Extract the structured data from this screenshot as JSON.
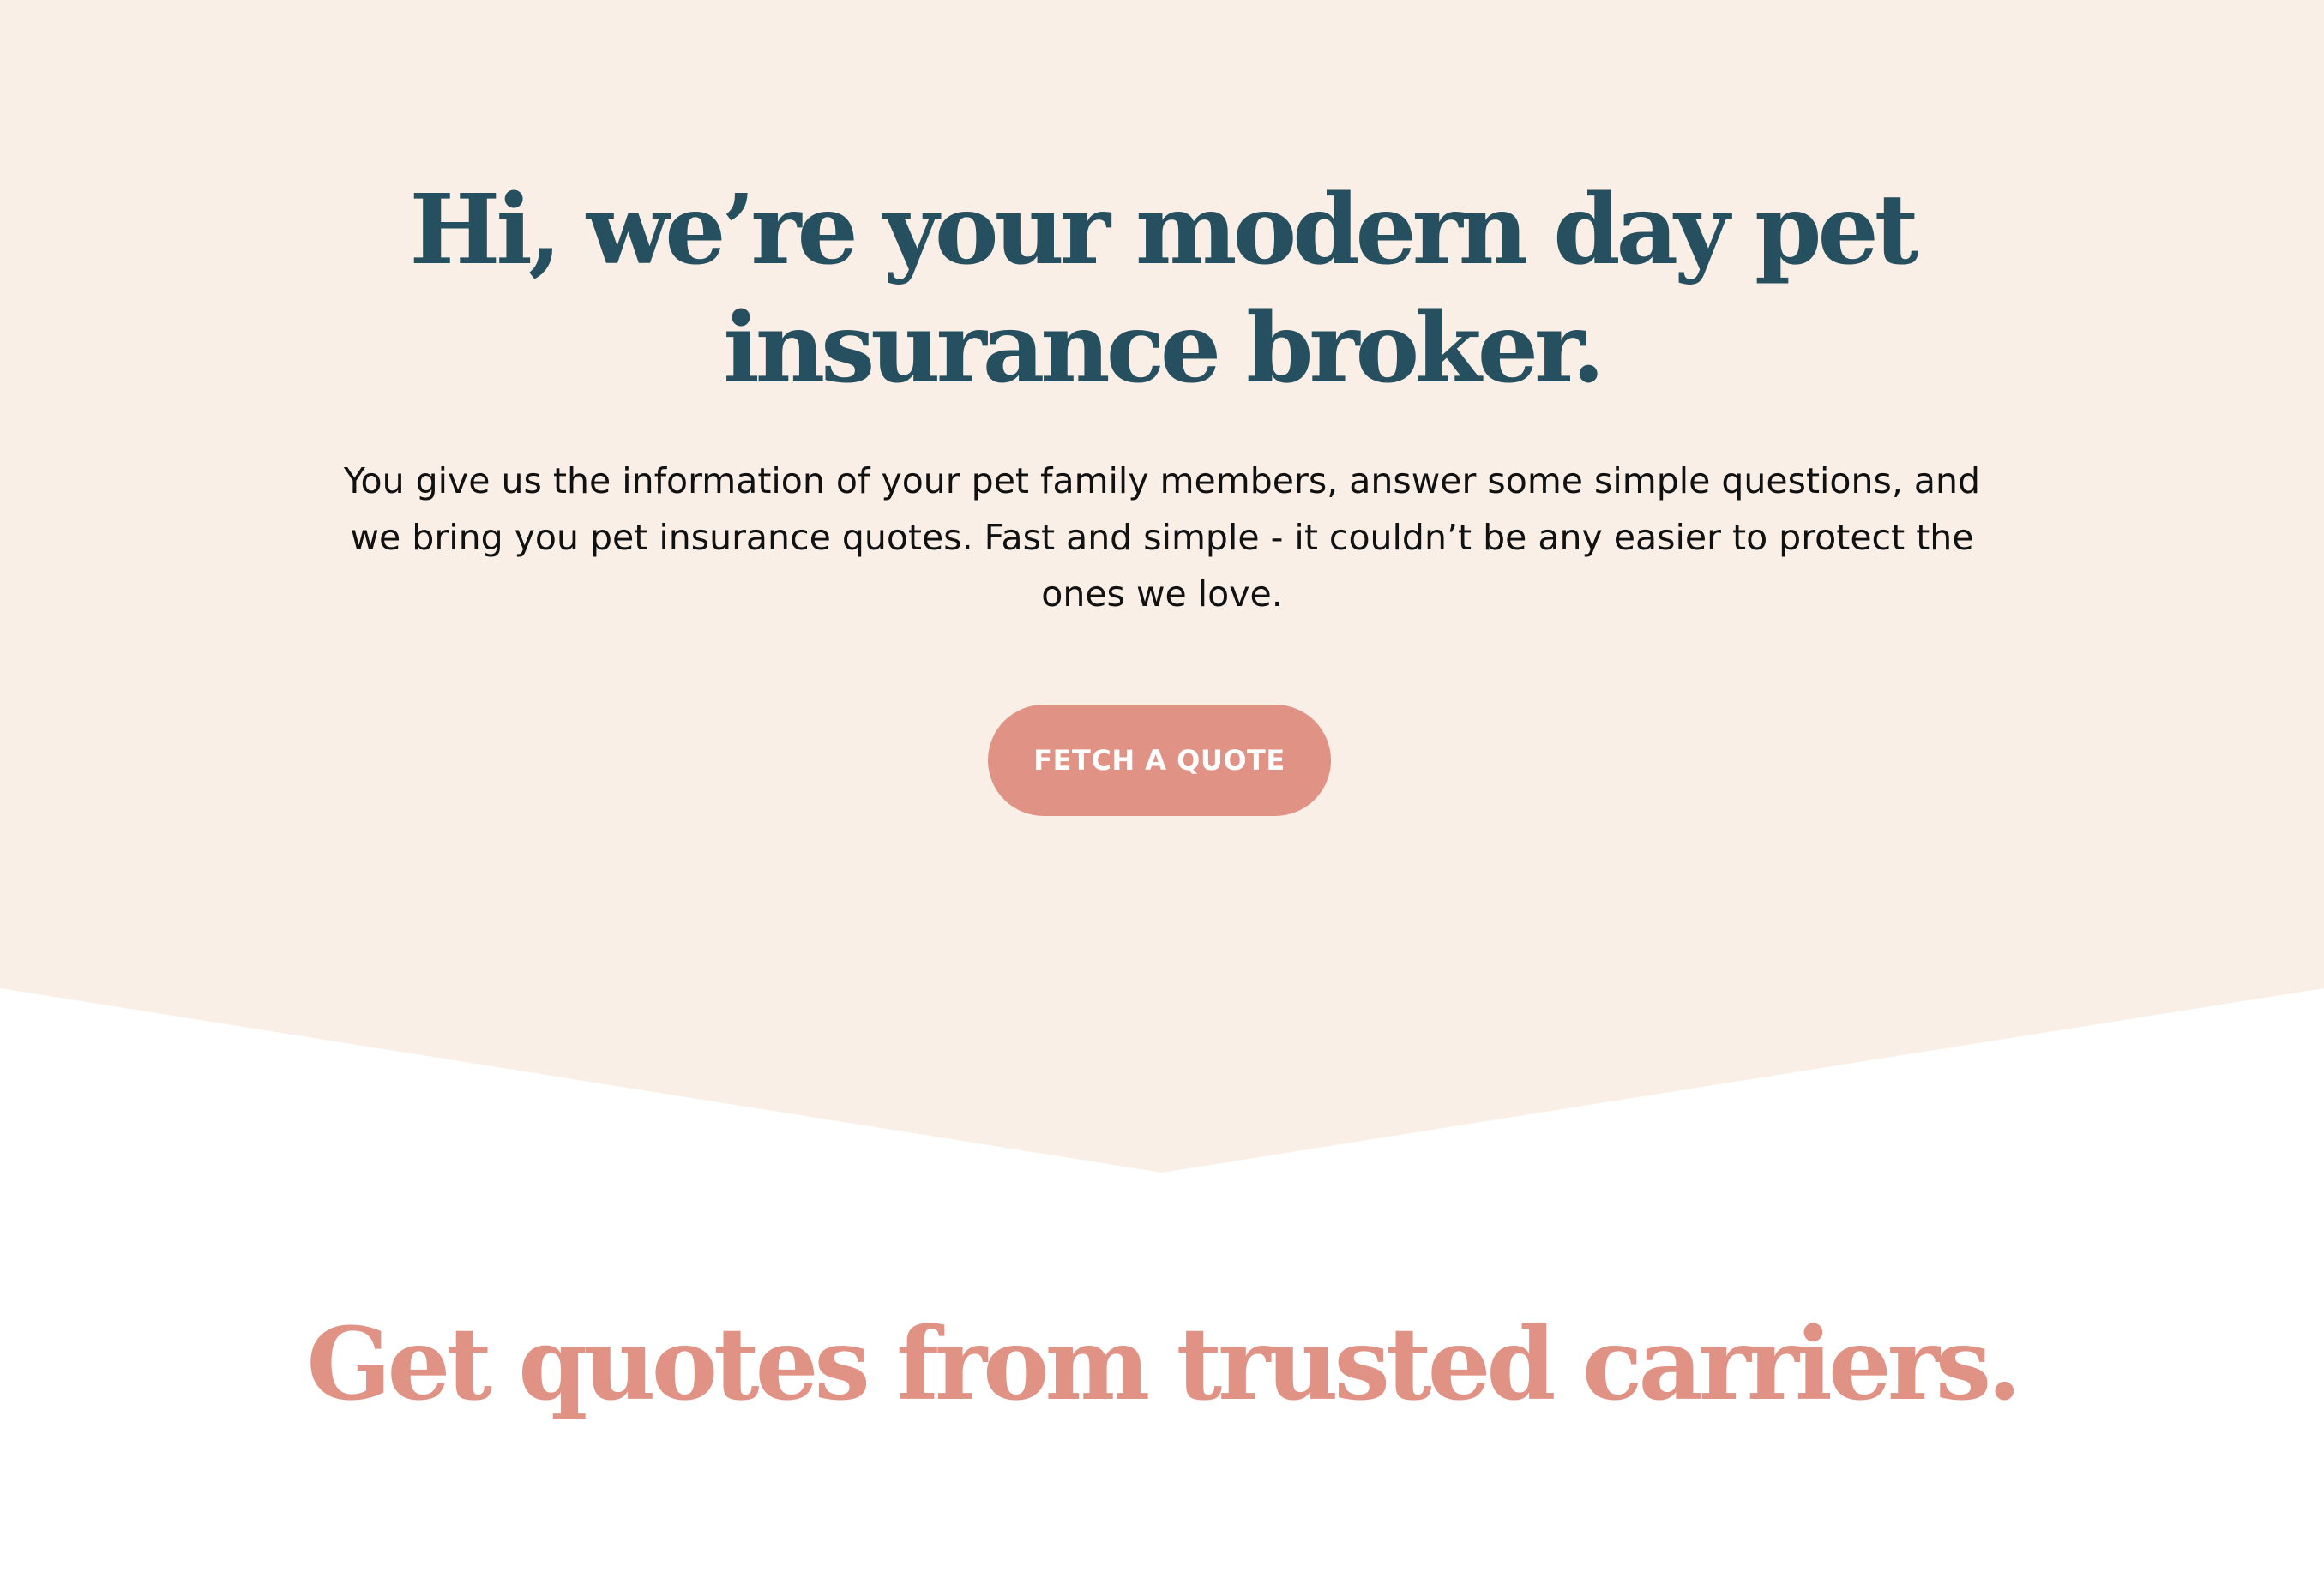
{
  "colors": {
    "hero_background": "#f9efe7",
    "page_background": "#ffffff",
    "heading_navy": "#26505f",
    "accent_salmon": "#e09285",
    "button_text": "#ffffff",
    "body_text": "#111111"
  },
  "hero": {
    "title_line1": "Hi, we’re your modern day pet",
    "title_line2": "insurance broker.",
    "description": "You give us the information of your pet family members, answer some simple questions, and we bring you pet insurance quotes.  Fast and simple - it couldn’t be any easier to protect the ones we love.",
    "cta_label": "FETCH A QUOTE"
  },
  "carriers": {
    "heading": "Get quotes from trusted carriers."
  }
}
